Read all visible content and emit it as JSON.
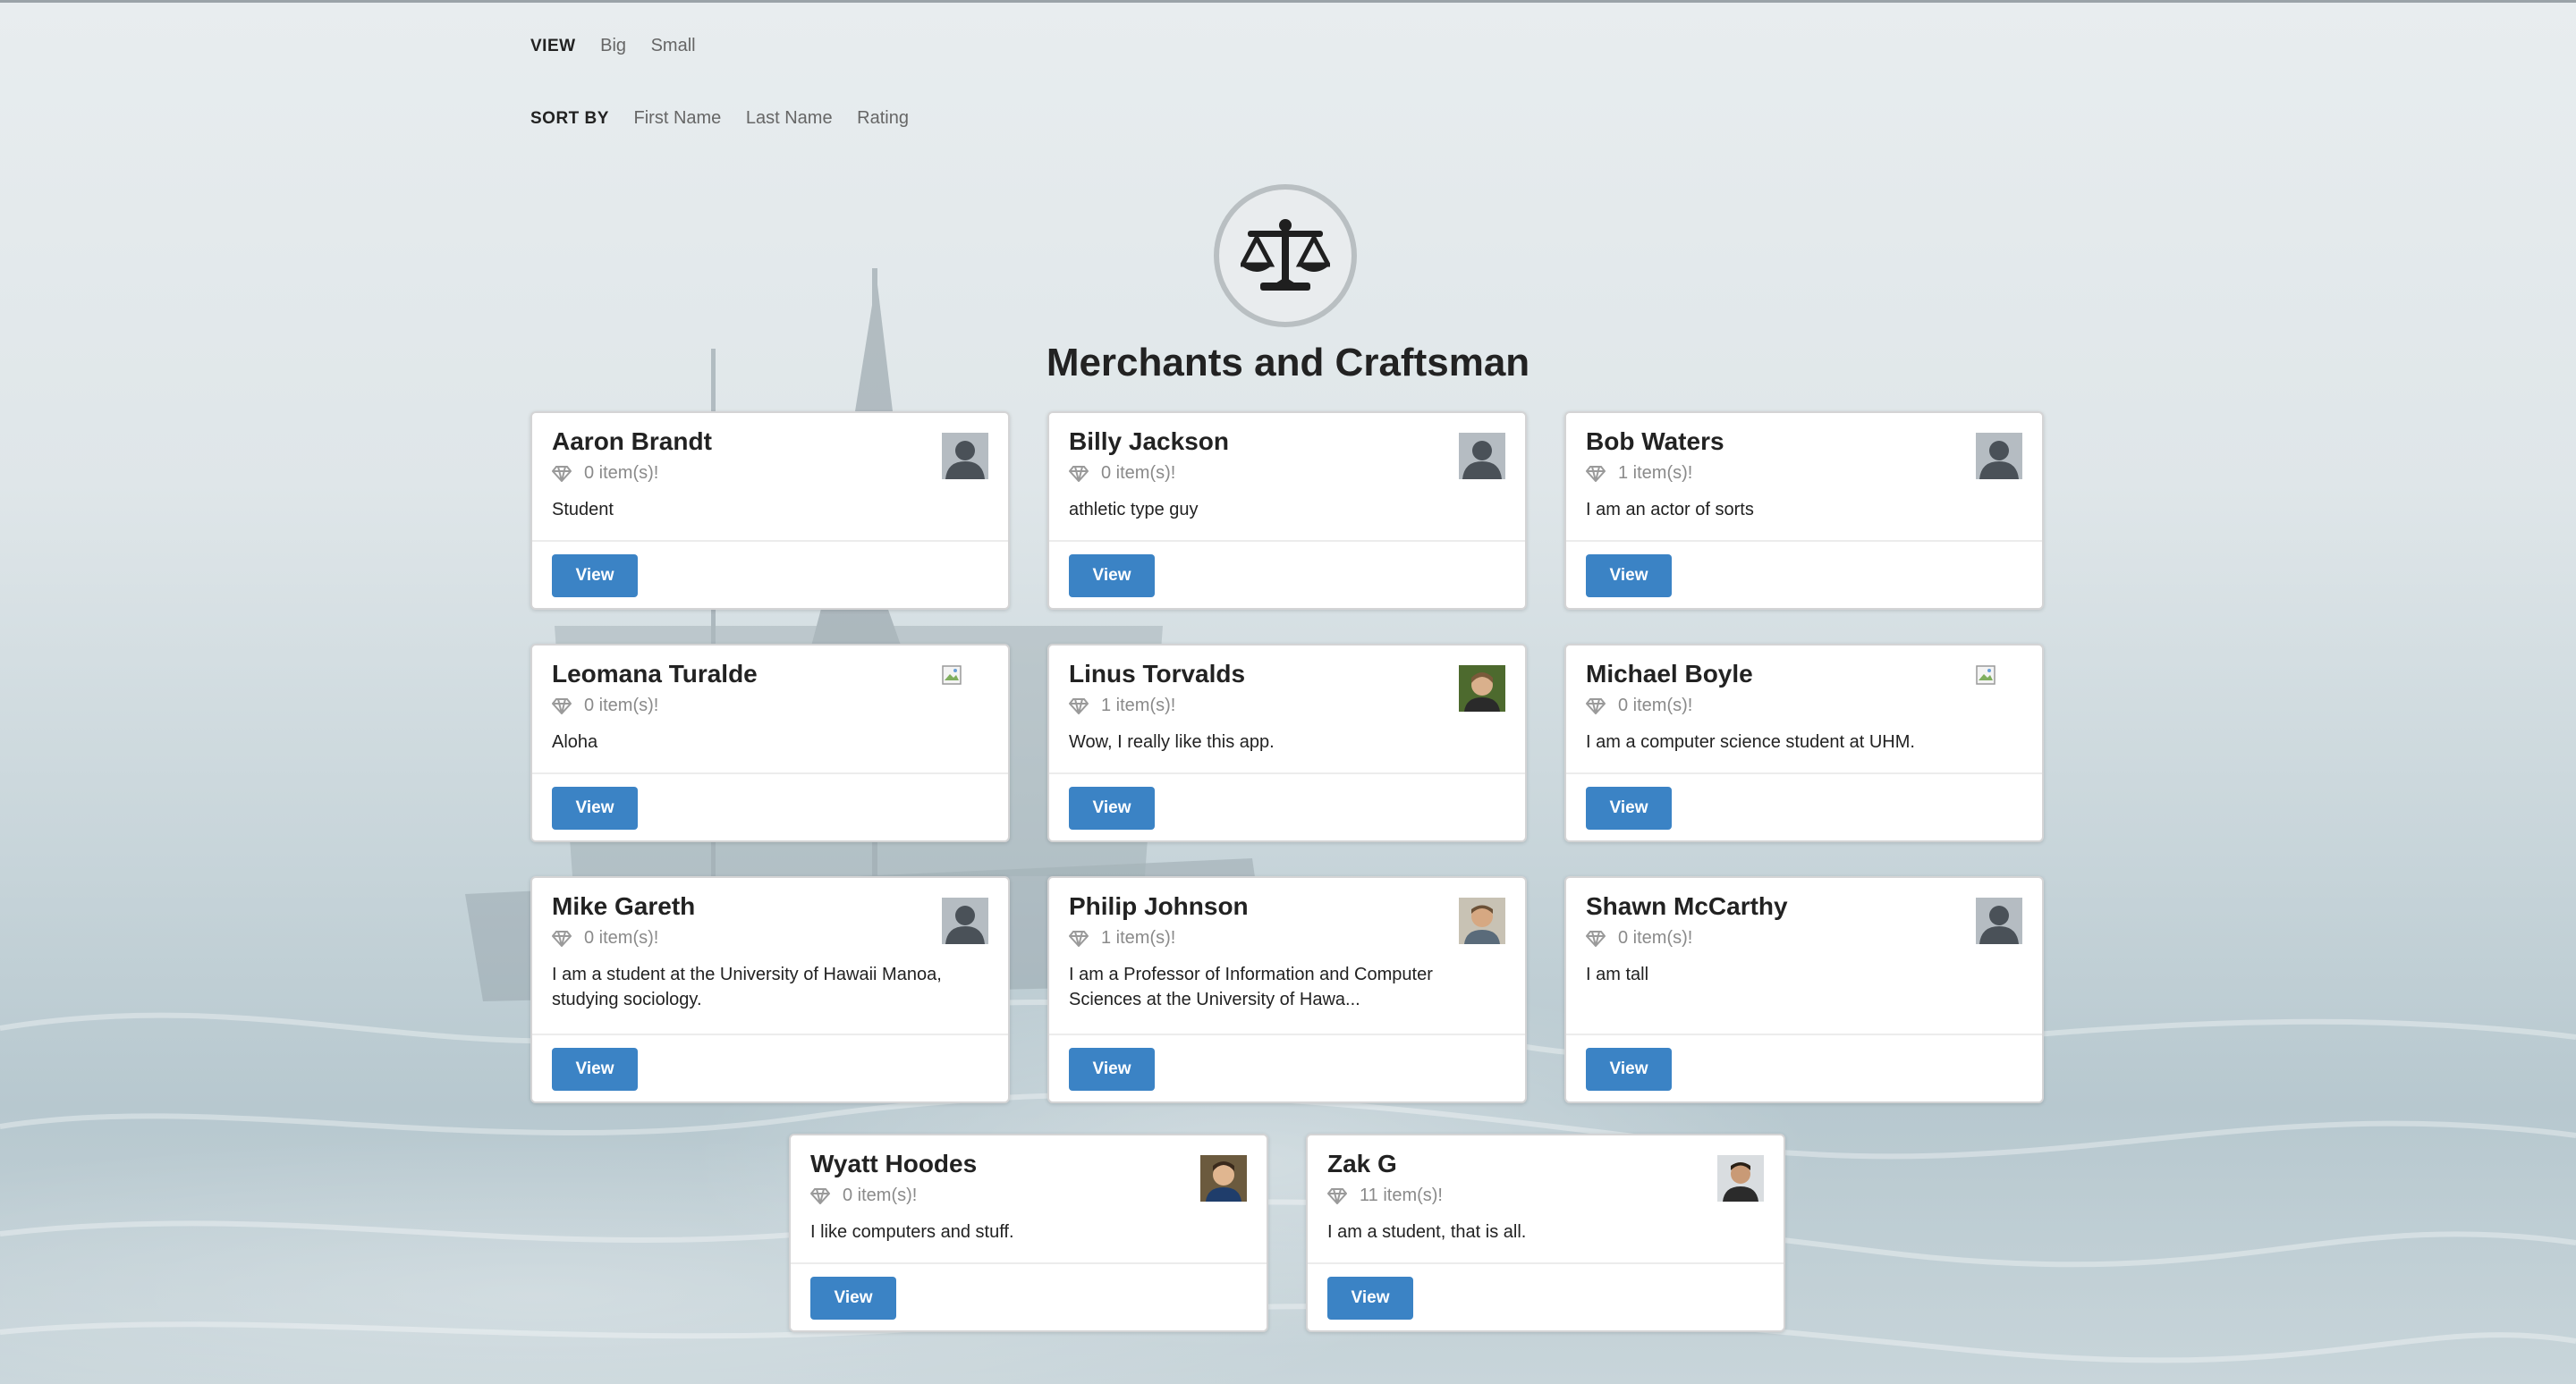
{
  "view": {
    "label": "VIEW",
    "options": [
      "Big",
      "Small"
    ]
  },
  "sort": {
    "label": "SORT BY",
    "options": [
      "First Name",
      "Last Name",
      "Rating"
    ]
  },
  "page_title": "Merchants and Craftsman",
  "emblem_icon": "balance-scale-icon",
  "button_label": "View",
  "colors": {
    "button": "#3b83c5",
    "title": "#222222",
    "muted": "#8a8a8a"
  },
  "cards": [
    {
      "name": "Aaron Brandt",
      "items": "0 item(s)!",
      "description": "Student",
      "avatar": "default-user"
    },
    {
      "name": "Billy Jackson",
      "items": "0 item(s)!",
      "description": "athletic type guy",
      "avatar": "default-user"
    },
    {
      "name": "Bob Waters",
      "items": "1 item(s)!",
      "description": "I am an actor of sorts",
      "avatar": "default-user"
    },
    {
      "name": "Leomana Turalde",
      "items": "0 item(s)!",
      "description": "Aloha",
      "avatar": "broken-image"
    },
    {
      "name": "Linus Torvalds",
      "items": "1 item(s)!",
      "description": "Wow, I really like this app.",
      "avatar": "photo"
    },
    {
      "name": "Michael Boyle",
      "items": "0 item(s)!",
      "description": "I am a computer science student at UHM.",
      "avatar": "broken-image"
    },
    {
      "name": "Mike Gareth",
      "items": "0 item(s)!",
      "description": "I am a student at the University of Hawaii Manoa, studying sociology.",
      "avatar": "default-user"
    },
    {
      "name": "Philip Johnson",
      "items": "1 item(s)!",
      "description": "I am a Professor of Information and Computer Sciences at the University of Hawa...",
      "avatar": "photo"
    },
    {
      "name": "Shawn McCarthy",
      "items": "0 item(s)!",
      "description": "I am tall",
      "avatar": "default-user"
    },
    {
      "name": "Wyatt Hoodes",
      "items": "0 item(s)!",
      "description": "I like computers and stuff.",
      "avatar": "photo"
    },
    {
      "name": "Zak G",
      "items": "11 item(s)!",
      "description": "I am a student, that is all.",
      "avatar": "photo"
    }
  ]
}
